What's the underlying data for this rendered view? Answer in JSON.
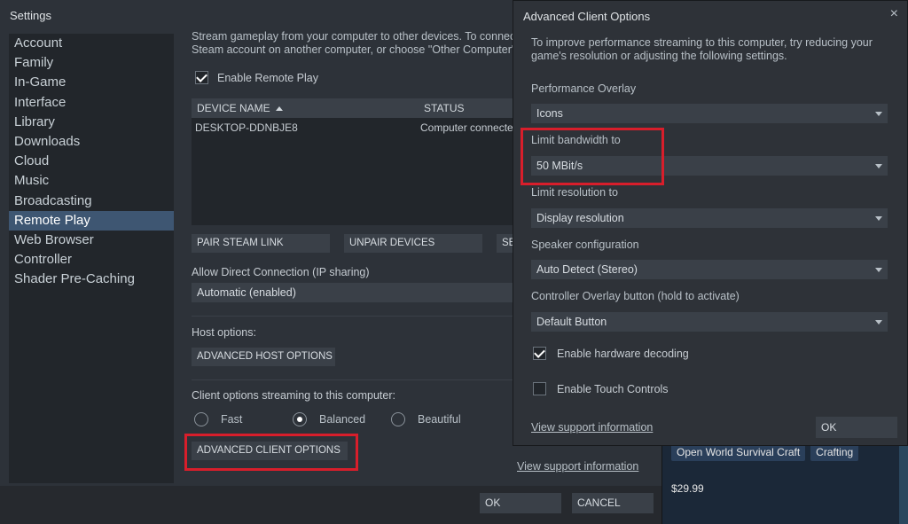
{
  "background": {
    "tags": [
      "Open World Survival Craft",
      "Crafting"
    ],
    "price": "$29.99"
  },
  "settings": {
    "title": "Settings",
    "sidebar": [
      {
        "label": "Account",
        "active": false
      },
      {
        "label": "Family",
        "active": false
      },
      {
        "label": "In-Game",
        "active": false
      },
      {
        "label": "Interface",
        "active": false
      },
      {
        "label": "Library",
        "active": false
      },
      {
        "label": "Downloads",
        "active": false
      },
      {
        "label": "Cloud",
        "active": false
      },
      {
        "label": "Music",
        "active": false
      },
      {
        "label": "Broadcasting",
        "active": false
      },
      {
        "label": "Remote Play",
        "active": true
      },
      {
        "label": "Web Browser",
        "active": false
      },
      {
        "label": "Controller",
        "active": false
      },
      {
        "label": "Shader Pre-Caching",
        "active": false
      }
    ],
    "intro_line1": "Stream gameplay from your computer to other devices. To connect,",
    "intro_line2": "Steam account on another computer, or choose \"Other Computer\" c",
    "enable_remote_play": "Enable Remote Play",
    "device_table": {
      "col_device": "DEVICE NAME",
      "col_status": "STATUS",
      "rows": [
        {
          "device": "DESKTOP-DDNBJE8",
          "status": "Computer connected"
        }
      ]
    },
    "pair_button": "PAIR STEAM LINK",
    "unpair_button": "UNPAIR DEVICES",
    "third_button": "SE",
    "direct_connection_label": "Allow Direct Connection (IP sharing)",
    "direct_connection_value": "Automatic (enabled)",
    "host_options_label": "Host options:",
    "advanced_host_button": "ADVANCED HOST OPTIONS",
    "client_options_label": "Client options streaming to this computer:",
    "radio_fast": "Fast",
    "radio_balanced": "Balanced",
    "radio_beautiful": "Beautiful",
    "advanced_client_button": "ADVANCED CLIENT OPTIONS",
    "support_link": "View support information",
    "ok_button": "OK",
    "cancel_button": "CANCEL"
  },
  "dialog": {
    "title": "Advanced Client Options",
    "close_icon": "×",
    "intro_line1": "To improve performance streaming to this computer, try reducing your",
    "intro_line2": "game's resolution or adjusting the following settings.",
    "performance_overlay_label": "Performance Overlay",
    "performance_overlay_value": "Icons",
    "bandwidth_label": "Limit bandwidth to",
    "bandwidth_value": "50 MBit/s",
    "resolution_label": "Limit resolution to",
    "resolution_value": "Display resolution",
    "speaker_label": "Speaker configuration",
    "speaker_value": "Auto Detect (Stereo)",
    "controller_overlay_label": "Controller Overlay button (hold to activate)",
    "controller_overlay_value": "Default Button",
    "hw_decoding_label": "Enable hardware decoding",
    "hw_decoding_checked": true,
    "touch_controls_label": "Enable Touch Controls",
    "touch_controls_checked": false,
    "support_link": "View support information",
    "ok_button": "OK"
  },
  "colors": {
    "highlight": "#d81e2b",
    "active_sidebar": "#3e5672"
  }
}
